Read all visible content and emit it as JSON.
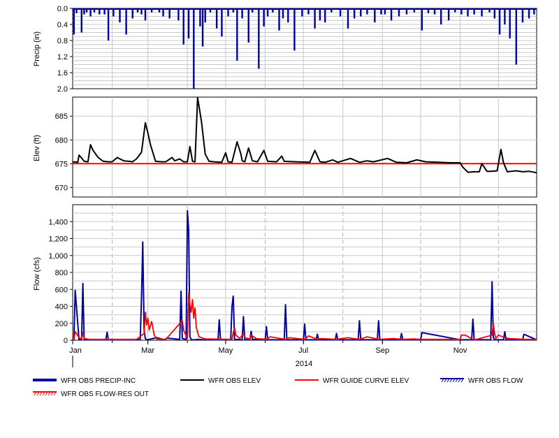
{
  "chart_data": [
    {
      "panel": "precip",
      "type": "bar",
      "ylabel": "Precip (in)",
      "ylim": [
        0,
        2.0
      ],
      "y_inverted": true,
      "yticks": [
        "0.0",
        "0.4",
        "0.8",
        "1.2",
        "1.6",
        "2.0"
      ],
      "color": "#0000a0",
      "series": [
        {
          "name": "WFR OBS PRECIP-INC",
          "x": [
            "2014-01-02",
            "2014-01-04",
            "2014-01-08",
            "2014-01-10",
            "2014-01-12",
            "2014-01-15",
            "2014-01-18",
            "2014-01-22",
            "2014-01-26",
            "2014-01-29",
            "2014-02-02",
            "2014-02-07",
            "2014-02-12",
            "2014-02-17",
            "2014-02-21",
            "2014-02-24",
            "2014-02-27",
            "2014-03-04",
            "2014-03-10",
            "2014-03-13",
            "2014-03-18",
            "2014-03-25",
            "2014-03-29",
            "2014-04-02",
            "2014-04-06",
            "2014-04-11",
            "2014-04-13",
            "2014-04-15",
            "2014-04-19",
            "2014-04-24",
            "2014-04-28",
            "2014-05-03",
            "2014-05-07",
            "2014-05-10",
            "2014-05-14",
            "2014-05-19",
            "2014-05-22",
            "2014-05-27",
            "2014-05-31",
            "2014-06-03",
            "2014-06-07",
            "2014-06-12",
            "2014-06-15",
            "2014-06-19",
            "2014-06-24",
            "2014-06-30",
            "2014-07-05",
            "2014-07-10",
            "2014-07-14",
            "2014-07-18",
            "2014-07-23",
            "2014-07-30",
            "2014-08-05",
            "2014-08-10",
            "2014-08-15",
            "2014-08-20",
            "2014-08-26",
            "2014-08-31",
            "2014-09-03",
            "2014-09-08",
            "2014-09-14",
            "2014-09-20",
            "2014-09-26",
            "2014-10-02",
            "2014-10-07",
            "2014-10-12",
            "2014-10-17",
            "2014-10-23",
            "2014-10-28",
            "2014-11-02",
            "2014-11-07",
            "2014-11-12",
            "2014-11-18",
            "2014-11-24",
            "2014-11-28",
            "2014-12-02",
            "2014-12-06",
            "2014-12-10",
            "2014-12-15",
            "2014-12-20",
            "2014-12-25",
            "2014-12-29"
          ],
          "values": [
            0.65,
            0.12,
            0.6,
            0.15,
            0.1,
            0.2,
            0.1,
            0.15,
            0.15,
            0.8,
            0.2,
            0.35,
            0.65,
            0.25,
            0.1,
            0.15,
            0.3,
            0.1,
            0.1,
            0.2,
            0.25,
            0.3,
            0.9,
            0.75,
            2.0,
            0.45,
            0.95,
            0.35,
            0.1,
            0.5,
            0.7,
            0.2,
            0.1,
            1.3,
            0.25,
            0.85,
            0.1,
            1.5,
            0.45,
            0.2,
            0.1,
            0.55,
            0.25,
            0.35,
            1.05,
            0.2,
            0.15,
            0.5,
            0.3,
            0.35,
            0.1,
            0.2,
            0.5,
            0.25,
            0.2,
            0.15,
            0.35,
            0.15,
            0.15,
            0.3,
            0.2,
            0.15,
            0.1,
            0.55,
            0.12,
            0.15,
            0.4,
            0.3,
            0.1,
            0.15,
            0.2,
            0.15,
            0.2,
            0.1,
            0.25,
            0.65,
            0.4,
            0.75,
            1.4,
            0.35,
            0.25,
            0.15
          ]
        }
      ]
    },
    {
      "panel": "elev",
      "type": "line",
      "ylabel": "Elev (ft)",
      "ylim": [
        668,
        689
      ],
      "yticks": [
        670,
        675,
        680,
        685
      ],
      "series": [
        {
          "name": "WFR OBS ELEV",
          "color": "#000000",
          "x": [
            "2014-01-01",
            "2014-01-05",
            "2014-01-06",
            "2014-01-08",
            "2014-01-10",
            "2014-01-13",
            "2014-01-15",
            "2014-01-17",
            "2014-01-21",
            "2014-01-25",
            "2014-01-29",
            "2014-02-01",
            "2014-02-05",
            "2014-02-10",
            "2014-02-14",
            "2014-02-17",
            "2014-02-20",
            "2014-02-24",
            "2014-02-27",
            "2014-03-01",
            "2014-03-03",
            "2014-03-07",
            "2014-03-12",
            "2014-03-15",
            "2014-03-20",
            "2014-03-22",
            "2014-03-26",
            "2014-03-29",
            "2014-04-01",
            "2014-04-03",
            "2014-04-05",
            "2014-04-07",
            "2014-04-09",
            "2014-04-12",
            "2014-04-15",
            "2014-04-18",
            "2014-04-22",
            "2014-04-28",
            "2014-05-01",
            "2014-05-03",
            "2014-05-06",
            "2014-05-10",
            "2014-05-13",
            "2014-05-14",
            "2014-05-16",
            "2014-05-19",
            "2014-05-22",
            "2014-05-26",
            "2014-05-31",
            "2014-06-03",
            "2014-06-10",
            "2014-06-14",
            "2014-06-16",
            "2014-06-25",
            "2014-07-06",
            "2014-07-10",
            "2014-07-14",
            "2014-07-18",
            "2014-07-24",
            "2014-07-28",
            "2014-08-07",
            "2014-08-14",
            "2014-08-20",
            "2014-08-25",
            "2014-09-05",
            "2014-09-12",
            "2014-09-20",
            "2014-09-28",
            "2014-10-05",
            "2014-10-15",
            "2014-10-25",
            "2014-11-01",
            "2014-11-03",
            "2014-11-07",
            "2014-11-12",
            "2014-11-16",
            "2014-11-18",
            "2014-11-22",
            "2014-11-25",
            "2014-11-30",
            "2014-12-03",
            "2014-12-05",
            "2014-12-08",
            "2014-12-11",
            "2014-12-15",
            "2014-12-20",
            "2014-12-25",
            "2014-12-31"
          ],
          "values": [
            675.4,
            675.3,
            676.8,
            676.2,
            675.5,
            675.4,
            679.0,
            677.8,
            676.3,
            675.5,
            675.4,
            675.4,
            676.3,
            675.6,
            675.5,
            675.4,
            676.0,
            677.4,
            683.6,
            681.5,
            679.0,
            675.5,
            675.4,
            675.4,
            676.3,
            675.6,
            676.0,
            675.4,
            675.4,
            678.6,
            675.5,
            675.4,
            688.9,
            684.0,
            677.0,
            675.5,
            675.4,
            675.3,
            677.3,
            675.4,
            675.3,
            679.6,
            677.0,
            675.6,
            675.4,
            678.3,
            675.6,
            675.4,
            677.8,
            675.5,
            675.4,
            676.6,
            675.5,
            675.4,
            675.3,
            677.8,
            675.4,
            675.3,
            675.8,
            675.3,
            676.1,
            675.3,
            675.6,
            675.4,
            676.1,
            675.3,
            675.2,
            675.8,
            675.4,
            675.3,
            675.2,
            675.2,
            674.3,
            673.2,
            673.3,
            673.3,
            675.0,
            673.4,
            673.4,
            673.5,
            678.0,
            675.2,
            673.3,
            673.4,
            673.5,
            673.3,
            673.4,
            673.1
          ]
        },
        {
          "name": "WFR GUIDE CURVE ELEV",
          "color": "#ff0000",
          "x": [
            "2014-01-01",
            "2014-12-31"
          ],
          "values": [
            675.0,
            675.0
          ]
        }
      ]
    },
    {
      "panel": "flow",
      "type": "line",
      "ylabel": "Flow (cfs)",
      "ylim": [
        0,
        1600
      ],
      "yticks": [
        "0",
        "200",
        "400",
        "600",
        "800",
        "1,000",
        "1,200",
        "1,400"
      ],
      "xlabel": "2014",
      "xticks": [
        "Jan",
        "Mar",
        "May",
        "Jul",
        "Sep",
        "Nov"
      ],
      "series": [
        {
          "name": "WFR OBS FLOW",
          "color": "#0000a0",
          "x": [
            "2014-01-01",
            "2014-01-02",
            "2014-01-03",
            "2014-01-06",
            "2014-01-08",
            "2014-01-09",
            "2014-01-10",
            "2014-01-12",
            "2014-01-27",
            "2014-01-28",
            "2014-01-29",
            "2014-02-18",
            "2014-02-23",
            "2014-02-24",
            "2014-02-25",
            "2014-02-26",
            "2014-02-27",
            "2014-02-28",
            "2014-03-02",
            "2014-03-08",
            "2014-03-14",
            "2014-03-16",
            "2014-03-26",
            "2014-03-27",
            "2014-03-28",
            "2014-03-31",
            "2014-04-01",
            "2014-04-02",
            "2014-04-03",
            "2014-04-04",
            "2014-04-05",
            "2014-04-07",
            "2014-04-09",
            "2014-04-13",
            "2014-04-25",
            "2014-04-26",
            "2014-04-27",
            "2014-05-05",
            "2014-05-06",
            "2014-05-07",
            "2014-05-08",
            "2014-05-14",
            "2014-05-15",
            "2014-05-16",
            "2014-05-20",
            "2014-05-21",
            "2014-05-22",
            "2014-06-01",
            "2014-06-02",
            "2014-06-03",
            "2014-06-16",
            "2014-06-17",
            "2014-06-18",
            "2014-07-01",
            "2014-07-02",
            "2014-07-03",
            "2014-07-11",
            "2014-07-12",
            "2014-07-13",
            "2014-07-26",
            "2014-07-27",
            "2014-07-28",
            "2014-08-13",
            "2014-08-14",
            "2014-08-15",
            "2014-08-28",
            "2014-08-29",
            "2014-08-30",
            "2014-09-15",
            "2014-09-16",
            "2014-09-17",
            "2014-10-01",
            "2014-10-02",
            "2014-11-01",
            "2014-11-10",
            "2014-11-11",
            "2014-11-12",
            "2014-11-25",
            "2014-11-26",
            "2014-11-27",
            "2014-11-28",
            "2014-12-05",
            "2014-12-06",
            "2014-12-07",
            "2014-12-20",
            "2014-12-21",
            "2014-12-31"
          ],
          "values": [
            5,
            5,
            590,
            5,
            10,
            670,
            8,
            5,
            5,
            95,
            5,
            5,
            10,
            500,
            1160,
            120,
            20,
            5,
            10,
            30,
            5,
            25,
            10,
            580,
            20,
            10,
            1530,
            1300,
            40,
            10,
            5,
            5,
            10,
            5,
            5,
            240,
            5,
            5,
            400,
            520,
            10,
            5,
            280,
            5,
            5,
            105,
            10,
            5,
            160,
            5,
            5,
            420,
            5,
            5,
            190,
            5,
            5,
            70,
            5,
            5,
            80,
            5,
            5,
            230,
            5,
            5,
            230,
            5,
            5,
            80,
            5,
            5,
            90,
            5,
            5,
            250,
            5,
            5,
            690,
            30,
            5,
            5,
            100,
            5,
            5,
            70,
            5
          ]
        },
        {
          "name": "WFR OBS FLOW-RES OUT",
          "color": "#ff0000",
          "x": [
            "2014-01-01",
            "2014-01-02",
            "2014-01-03",
            "2014-01-06",
            "2014-01-08",
            "2014-01-09",
            "2014-01-10",
            "2014-01-14",
            "2014-01-28",
            "2014-02-20",
            "2014-02-26",
            "2014-02-27",
            "2014-02-28",
            "2014-03-01",
            "2014-03-02",
            "2014-03-04",
            "2014-03-06",
            "2014-03-08",
            "2014-03-15",
            "2014-03-28",
            "2014-03-29",
            "2014-04-01",
            "2014-04-02",
            "2014-04-03",
            "2014-04-04",
            "2014-04-05",
            "2014-04-06",
            "2014-04-07",
            "2014-04-08",
            "2014-04-10",
            "2014-04-15",
            "2014-05-06",
            "2014-05-07",
            "2014-05-08",
            "2014-05-09",
            "2014-05-12",
            "2014-05-15",
            "2014-05-16",
            "2014-05-20",
            "2014-05-21",
            "2014-05-25",
            "2014-06-02",
            "2014-06-05",
            "2014-06-17",
            "2014-06-20",
            "2014-07-02",
            "2014-07-05",
            "2014-07-12",
            "2014-07-15",
            "2014-07-27",
            "2014-08-05",
            "2014-08-14",
            "2014-08-20",
            "2014-08-29",
            "2014-09-10",
            "2014-09-16",
            "2014-09-25",
            "2014-10-02",
            "2014-10-15",
            "2014-10-28",
            "2014-11-01",
            "2014-11-02",
            "2014-11-05",
            "2014-11-11",
            "2014-11-14",
            "2014-11-26",
            "2014-11-27",
            "2014-11-28",
            "2014-11-29",
            "2014-12-01",
            "2014-12-06",
            "2014-12-10",
            "2014-12-21",
            "2014-12-31"
          ],
          "values": [
            10,
            10,
            100,
            30,
            15,
            90,
            20,
            10,
            10,
            10,
            80,
            330,
            180,
            260,
            120,
            220,
            60,
            15,
            10,
            230,
            120,
            20,
            560,
            420,
            330,
            480,
            260,
            380,
            150,
            40,
            15,
            10,
            90,
            140,
            60,
            20,
            80,
            30,
            15,
            60,
            20,
            10,
            40,
            10,
            30,
            10,
            50,
            10,
            20,
            10,
            30,
            10,
            40,
            10,
            20,
            10,
            15,
            10,
            10,
            10,
            10,
            60,
            60,
            10,
            10,
            60,
            200,
            80,
            20,
            60,
            30,
            20,
            10,
            10
          ]
        }
      ]
    }
  ],
  "legend": [
    {
      "label": "WFR OBS PRECIP-INC",
      "color": "#0000a0",
      "style": "thick"
    },
    {
      "label": "WFR OBS ELEV",
      "color": "#000000",
      "style": "line"
    },
    {
      "label": "WFR GUIDE CURVE ELEV",
      "color": "#ff0000",
      "style": "line"
    },
    {
      "label": "WFR OBS FLOW",
      "color": "#0000a0",
      "style": "hatch"
    },
    {
      "label": "WFR OBS FLOW-RES OUT",
      "color": "#ff0000",
      "style": "hatch"
    }
  ]
}
